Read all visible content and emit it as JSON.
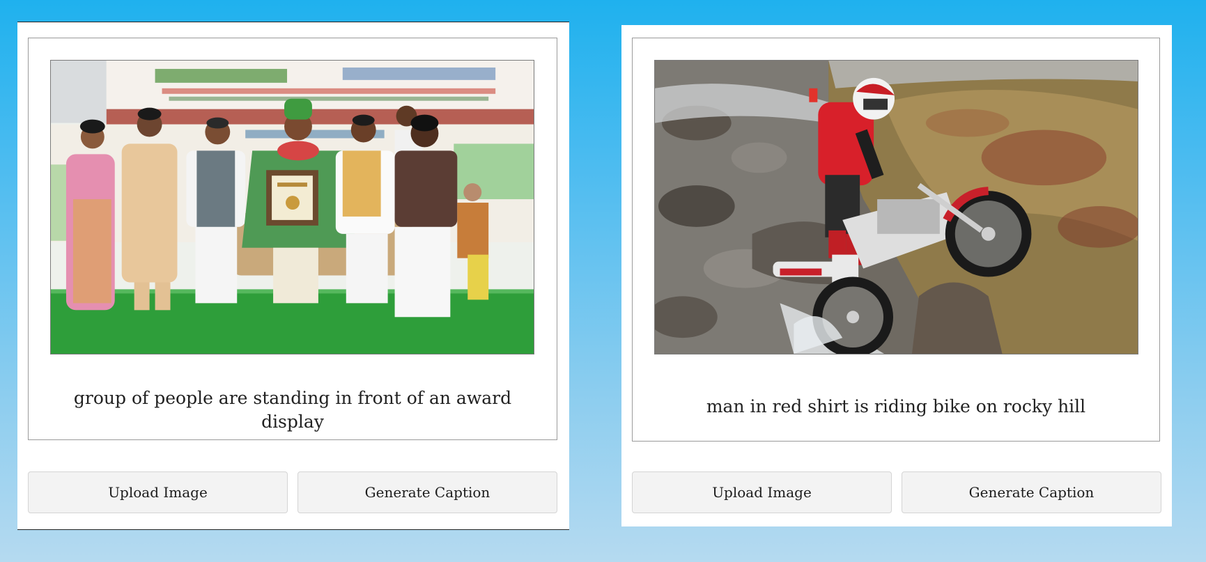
{
  "cards": [
    {
      "caption": "group of people are standing in front of an award display",
      "upload_label": "Upload Image",
      "generate_label": "Generate Caption"
    },
    {
      "caption": "man in red shirt is riding bike on rocky hill",
      "upload_label": "Upload Image",
      "generate_label": "Generate Caption"
    }
  ],
  "colors": {
    "background_top": "#1fb1ee",
    "background_bottom": "#b5daf0",
    "card": "#ffffff",
    "button": "#f3f3f3"
  }
}
